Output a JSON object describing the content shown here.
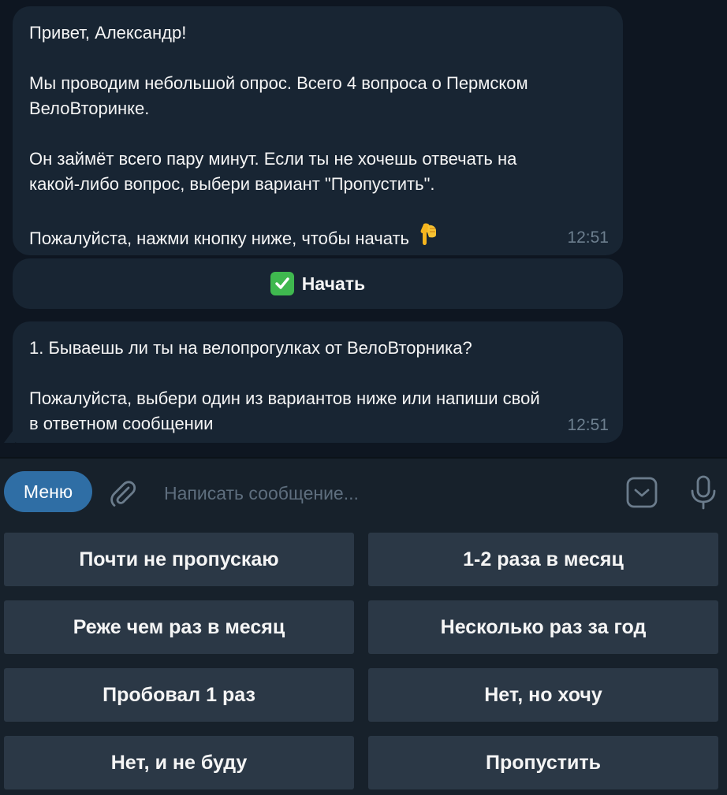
{
  "messages": [
    {
      "lines": [
        "Привет, Александр!",
        "",
        "Мы проводим небольшой опрос. Всего 4 вопроса о Пермском",
        "ВелоВторинке.",
        "",
        "Он займёт всего пару минут. Если ты не хочешь отвечать на",
        "какой-либо вопрос, выбери вариант \"Пропустить\".",
        "",
        "Пожалуйста, нажми кнопку ниже, чтобы начать"
      ],
      "trailing_icon": "pointing-down-emoji",
      "time": "12:51",
      "inline_button": {
        "icon": "check-mark-emoji",
        "label": "Начать"
      }
    },
    {
      "lines": [
        "1. Бываешь ли ты на велопрогулках от ВелоВторника?",
        "",
        "Пожалуйста, выбери один из вариантов ниже или напиши свой",
        "в ответном сообщении"
      ],
      "time": "12:51"
    }
  ],
  "composer": {
    "menu_label": "Меню",
    "placeholder": "Написать сообщение...",
    "attach_icon": "paperclip-icon",
    "keyboard_icon": "keyboard-toggle-icon",
    "mic_icon": "microphone-icon"
  },
  "reply_keyboard": [
    [
      "Почти не пропускаю",
      "1-2 раза в месяц"
    ],
    [
      "Реже чем раз в месяц",
      "Несколько раз за год"
    ],
    [
      "Пробовал 1 раз",
      "Нет, но хочу"
    ],
    [
      "Нет, и не буду",
      "Пропустить"
    ]
  ],
  "colors": {
    "chat_background": "#0e1621",
    "bubble": "#182533",
    "panel": "#17212b",
    "reply_button": "#2b3846",
    "menu_button": "#2f6ea5",
    "timestamp": "#6d7f8f",
    "placeholder": "#5e6e7e"
  }
}
